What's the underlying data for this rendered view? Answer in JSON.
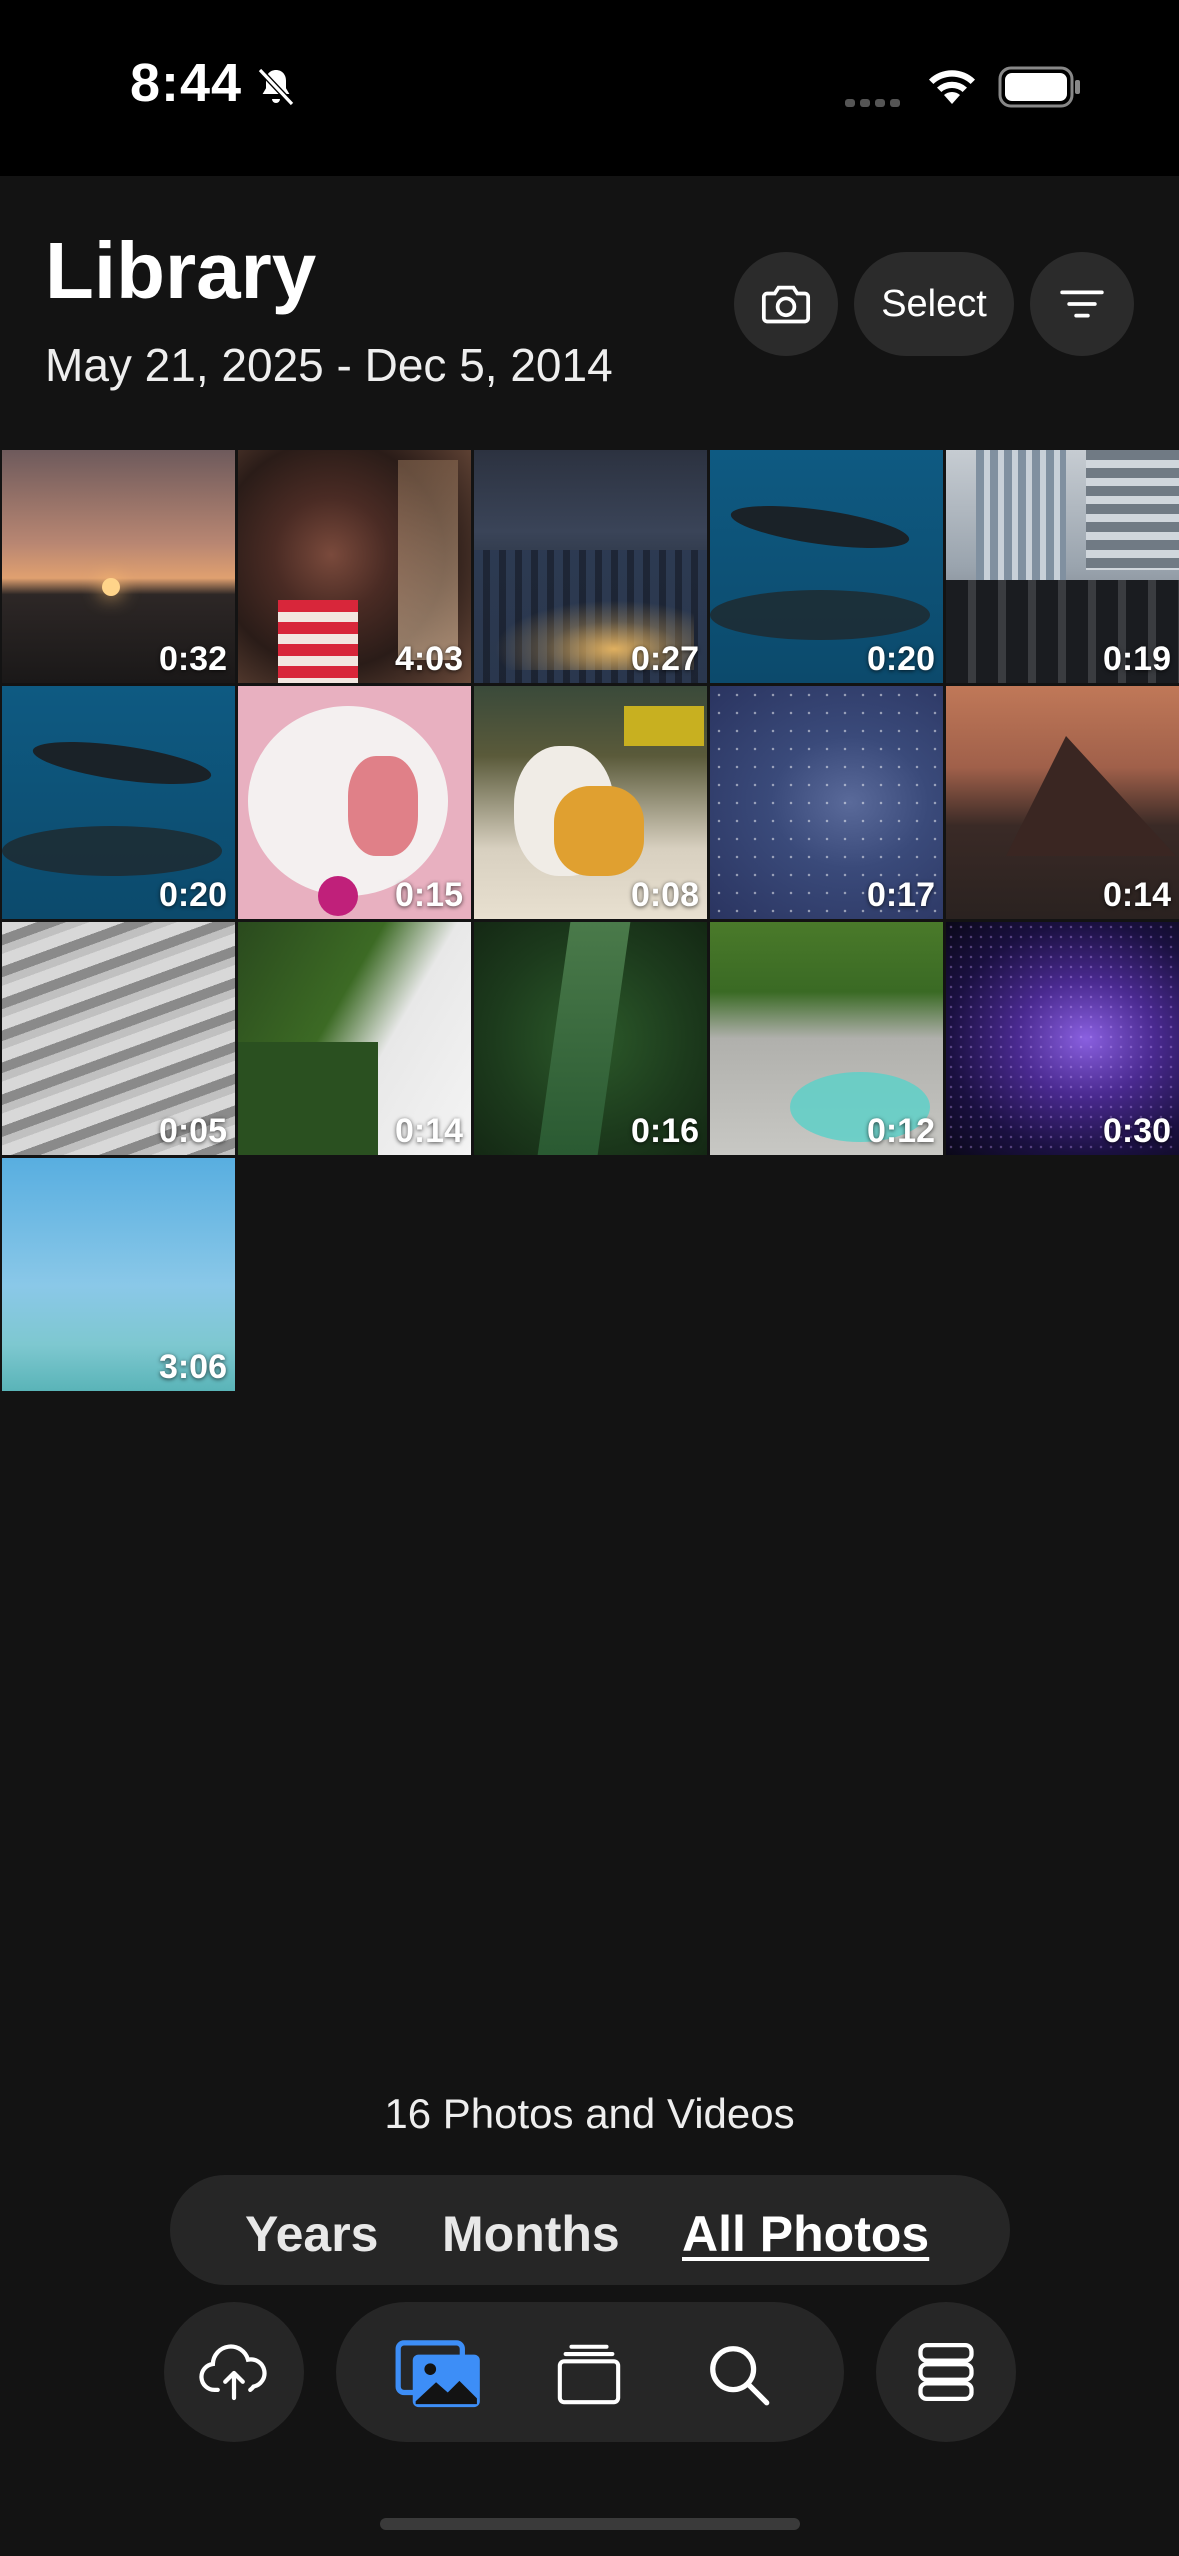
{
  "status_bar": {
    "time": "8:44"
  },
  "header": {
    "title": "Library",
    "date_range": "May 21, 2025 - Dec 5, 2014",
    "select_label": "Select"
  },
  "colors": {
    "accent": "#3d8ef7",
    "background": "#131313",
    "chip": "#2b2b2b"
  },
  "media": [
    {
      "duration": "0:32",
      "scene": "sunset-over-sea"
    },
    {
      "duration": "4:03",
      "scene": "child-in-scarf"
    },
    {
      "duration": "0:27",
      "scene": "city-at-night"
    },
    {
      "duration": "0:20",
      "scene": "whales-underwater"
    },
    {
      "duration": "0:19",
      "scene": "crowd-near-buildings"
    },
    {
      "duration": "0:20",
      "scene": "whales-underwater"
    },
    {
      "duration": "0:15",
      "scene": "plate-with-dessert"
    },
    {
      "duration": "0:08",
      "scene": "white-rabbit"
    },
    {
      "duration": "0:17",
      "scene": "starry-sky"
    },
    {
      "duration": "0:14",
      "scene": "mountain-at-dusk"
    },
    {
      "duration": "0:05",
      "scene": "abstract-waves"
    },
    {
      "duration": "0:14",
      "scene": "green-cliffs"
    },
    {
      "duration": "0:16",
      "scene": "jungle-aerial"
    },
    {
      "duration": "0:12",
      "scene": "coastline-aerial"
    },
    {
      "duration": "0:30",
      "scene": "purple-particles"
    },
    {
      "duration": "3:06",
      "scene": "sky-and-sea"
    }
  ],
  "footer": {
    "count_label": "16 Photos and Videos"
  },
  "view_switcher": {
    "years": "Years",
    "months": "Months",
    "all_photos": "All Photos",
    "selected": "All Photos"
  },
  "tab_bar": {
    "icons": [
      "cloud-upload-icon",
      "photos-icon",
      "albums-icon",
      "search-icon",
      "server-icon"
    ],
    "active": "photos-icon"
  }
}
